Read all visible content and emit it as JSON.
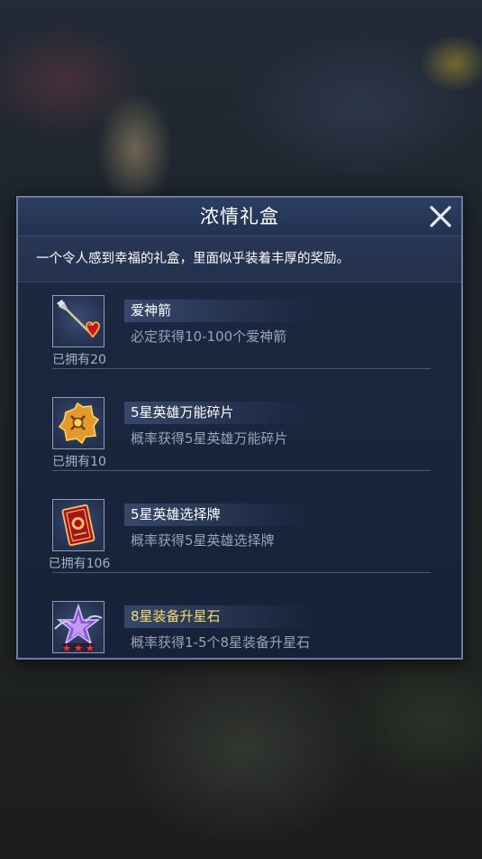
{
  "dialog": {
    "title": "浓情礼盒",
    "description": "一个令人感到幸福的礼盒，里面似乎装着丰厚的奖励。",
    "close_icon": "close-x-icon"
  },
  "rewards": [
    {
      "icon": "cupid-arrow-icon",
      "name": "爱神箭",
      "detail": "必定获得10-100个爱神箭",
      "owned": "已拥有20",
      "highlight": false
    },
    {
      "icon": "puzzle-shard-icon",
      "name": "5星英雄万能碎片",
      "detail": "概率获得5星英雄万能碎片",
      "owned": "已拥有10",
      "highlight": false
    },
    {
      "icon": "hero-card-icon",
      "name": "5星英雄选择牌",
      "detail": "概率获得5星英雄选择牌",
      "owned": "已拥有106",
      "highlight": false
    },
    {
      "icon": "star-stone-icon",
      "name": "8星装备升星石",
      "detail": "概率获得1-5个8星装备升星石",
      "owned": "",
      "highlight": true,
      "accent_color": "#f5df6a"
    }
  ]
}
